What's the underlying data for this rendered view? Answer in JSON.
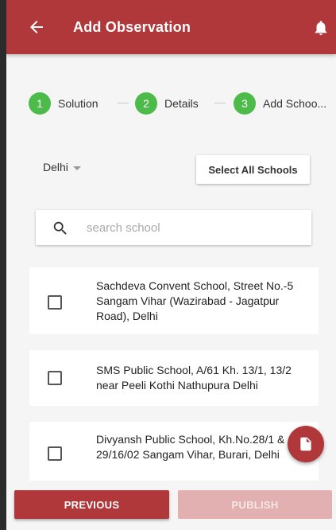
{
  "appbar": {
    "title": "Add Observation",
    "back_icon": "arrow-left-icon",
    "bell_icon": "bell-icon"
  },
  "stepper": {
    "steps": [
      {
        "number": "1",
        "label": "Solution"
      },
      {
        "number": "2",
        "label": "Details"
      },
      {
        "number": "3",
        "label": "Add Schoo..."
      }
    ],
    "color": "#4cbb4a"
  },
  "filter": {
    "state": "Delhi",
    "select_all_label": "Select All Schools"
  },
  "search": {
    "placeholder": "search school",
    "value": ""
  },
  "schools": [
    {
      "name": "Sachdeva Convent School, Street No.-5 Sangam Vihar (Wazirabad - Jagatpur Road), Delhi",
      "checked": false
    },
    {
      "name": "SMS Public School, A/61 Kh. 13/1, 13/2 near Peeli Kothi Nathupura Delhi",
      "checked": false
    },
    {
      "name": "Divyansh Public School, Kh.No.28/1 & 29/16/02 Sangam Vihar, Burari, Delhi",
      "checked": false
    }
  ],
  "fab": {
    "icon": "document-icon"
  },
  "footer": {
    "previous_label": "PREVIOUS",
    "publish_label": "PUBLISH"
  },
  "colors": {
    "primary": "#b0373a",
    "disabled": "#e3b0b1",
    "success": "#4cbb4a"
  }
}
